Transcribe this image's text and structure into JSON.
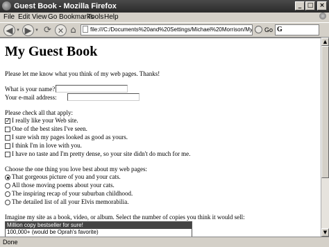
{
  "window": {
    "title": "Guest Book - Mozilla Firefox"
  },
  "menu": [
    "File",
    "Edit",
    "View",
    "Go",
    "Bookmarks",
    "Tools",
    "Help"
  ],
  "toolbar": {
    "url": "file:///C:/Documents%20and%20Settings/Michael%20Morrison/My%20Documents",
    "go_label": "Go",
    "search_prefix": "G"
  },
  "page": {
    "heading": "My Guest Book",
    "intro": "Please let me know what you think of my web pages. Thanks!",
    "name_label": "What is your name?",
    "email_label": "Your e-mail address:",
    "checks_prompt": "Please check all that apply:",
    "checks": [
      {
        "label": "I really like your Web site.",
        "checked": true
      },
      {
        "label": "One of the best sites I've seen.",
        "checked": false
      },
      {
        "label": "I sure wish my pages looked as good as yours.",
        "checked": false
      },
      {
        "label": "I think I'm in love with you.",
        "checked": false
      },
      {
        "label": "I have no taste and I'm pretty dense, so your site didn't do much for me.",
        "checked": false
      }
    ],
    "radio_prompt": "Choose the one thing you love best about my web pages:",
    "radios": [
      {
        "label": "That gorgeous picture of you and your cats.",
        "selected": true
      },
      {
        "label": "All those moving poems about your cats.",
        "selected": false
      },
      {
        "label": "The inspiring recap of your suburban childhood.",
        "selected": false
      },
      {
        "label": "The detailed list of all your Elvis memorabilia.",
        "selected": false
      }
    ],
    "select_prompt": "Imagine my site as a book, video, or album. Select the number of copies you think it would sell:",
    "options": [
      {
        "label": "Million copy bestseller for sure!",
        "selected": true
      },
      {
        "label": "100,000+ (would be Oprah's favorite)",
        "selected": false
      }
    ]
  },
  "status": "Done"
}
